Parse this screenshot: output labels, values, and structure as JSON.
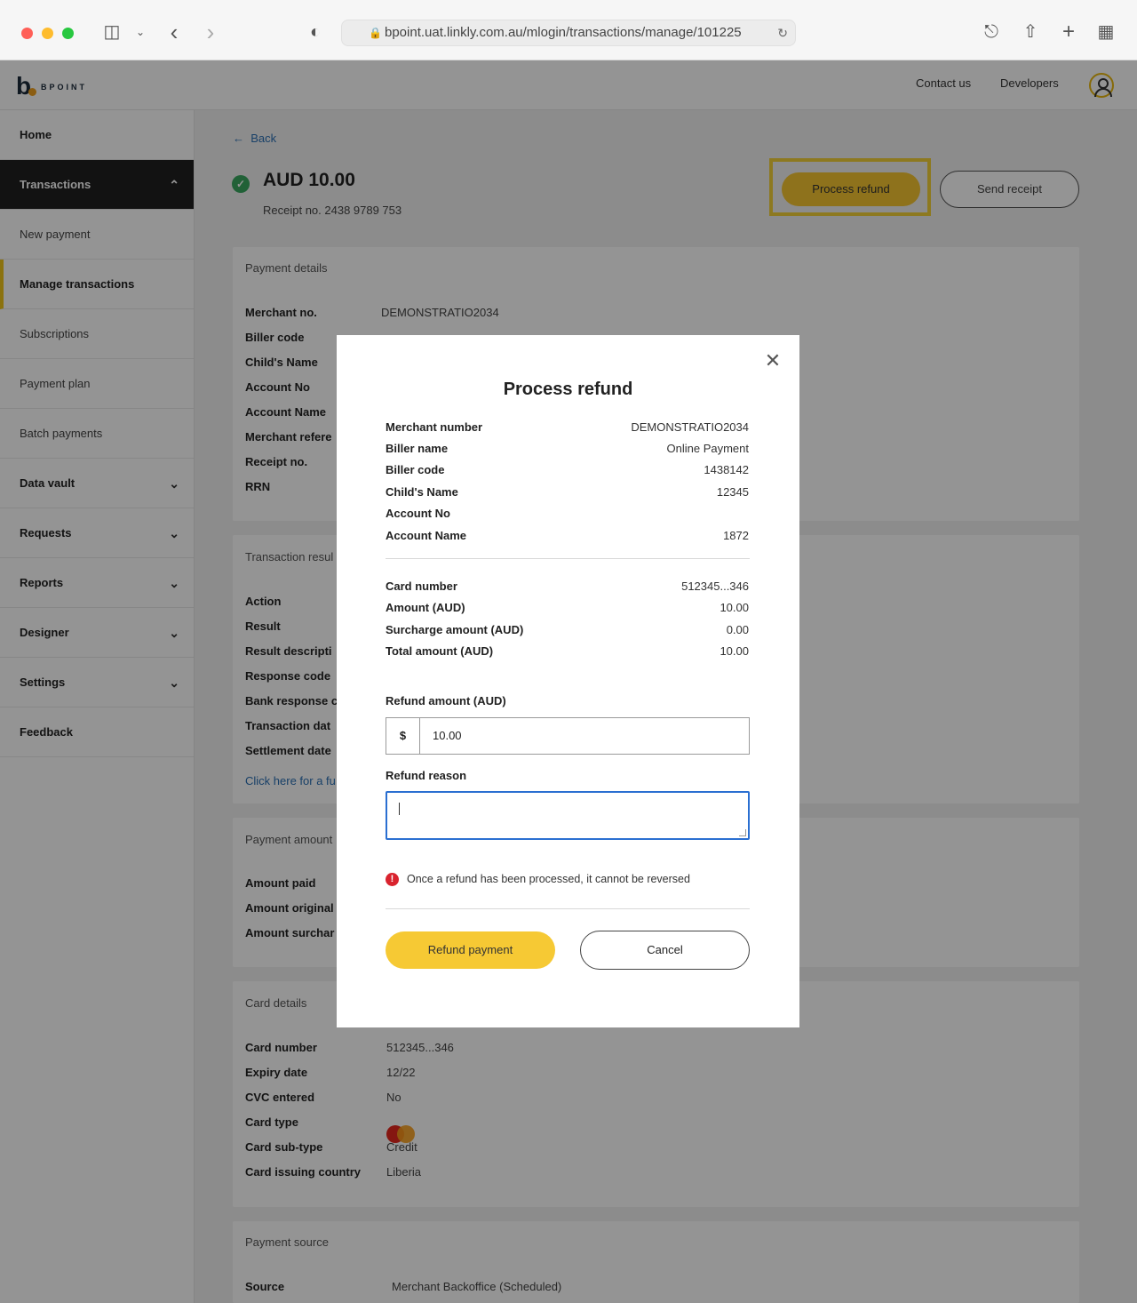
{
  "browser": {
    "url": "bpoint.uat.linkly.com.au/mlogin/transactions/manage/101225"
  },
  "header": {
    "brand": "BPOINT",
    "links": [
      "Contact us",
      "Developers"
    ]
  },
  "sidebar": {
    "items": [
      {
        "label": "Home"
      },
      {
        "label": "Transactions"
      },
      {
        "label": "New payment"
      },
      {
        "label": "Manage transactions"
      },
      {
        "label": "Subscriptions"
      },
      {
        "label": "Payment plan"
      },
      {
        "label": "Batch payments"
      },
      {
        "label": "Data vault"
      },
      {
        "label": "Requests"
      },
      {
        "label": "Reports"
      },
      {
        "label": "Designer"
      },
      {
        "label": "Settings"
      },
      {
        "label": "Feedback"
      }
    ]
  },
  "page": {
    "back": "Back",
    "amount": "AUD 10.00",
    "receipt": "Receipt no. 2438 9789 753",
    "process_refund": "Process refund",
    "send_receipt": "Send receipt",
    "status_color": "#3aa860",
    "accent_color": "#f4c431"
  },
  "payment_details": {
    "title": "Payment details",
    "rows": [
      {
        "label": "Merchant no.",
        "value": "DEMONSTRATIO2034"
      },
      {
        "label": "Biller code",
        "value": ""
      },
      {
        "label": "Child's Name",
        "value": ""
      },
      {
        "label": "Account No",
        "value": ""
      },
      {
        "label": "Account Name",
        "value": ""
      },
      {
        "label": "Merchant refere",
        "value": ""
      },
      {
        "label": "Receipt no.",
        "value": ""
      },
      {
        "label": "RRN",
        "value": ""
      }
    ]
  },
  "transaction_result": {
    "title": "Transaction resul",
    "rows": [
      {
        "label": "Action"
      },
      {
        "label": "Result"
      },
      {
        "label": "Result descripti"
      },
      {
        "label": "Response code"
      },
      {
        "label": "Bank response c"
      },
      {
        "label": "Transaction dat"
      },
      {
        "label": "Settlement date"
      }
    ],
    "link": "Click here for a fu"
  },
  "payment_amount": {
    "title": "Payment amount",
    "rows": [
      {
        "label": "Amount paid"
      },
      {
        "label": "Amount original"
      },
      {
        "label": "Amount surchar"
      }
    ]
  },
  "card_details": {
    "title": "Card details",
    "rows": [
      {
        "label": "Card number",
        "value": "512345...346"
      },
      {
        "label": "Expiry date",
        "value": "12/22"
      },
      {
        "label": "CVC entered",
        "value": "No"
      },
      {
        "label": "Card type",
        "value": ""
      },
      {
        "label": "Card sub-type",
        "value": "Credit"
      },
      {
        "label": "Card issuing country",
        "value": "Liberia"
      }
    ],
    "card_type_icon": "mastercard-icon"
  },
  "payment_source": {
    "title": "Payment source",
    "rows": [
      {
        "label": "Source",
        "value": "Merchant Backoffice (Scheduled)"
      }
    ]
  },
  "modal": {
    "title": "Process refund",
    "details": [
      {
        "label": "Merchant number",
        "value": "DEMONSTRATIO2034"
      },
      {
        "label": "Biller name",
        "value": "Online Payment"
      },
      {
        "label": "Biller code",
        "value": "1438142"
      },
      {
        "label": "Child's Name",
        "value": "12345"
      },
      {
        "label": "Account No",
        "value": ""
      },
      {
        "label": "Account Name",
        "value": "1872"
      }
    ],
    "amounts": [
      {
        "label": "Card number",
        "value": "512345...346"
      },
      {
        "label": "Amount (AUD)",
        "value": "10.00"
      },
      {
        "label": "Surcharge amount (AUD)",
        "value": "0.00"
      },
      {
        "label": "Total amount (AUD)",
        "value": "10.00"
      }
    ],
    "refund_amount_label": "Refund amount (AUD)",
    "currency_symbol": "$",
    "refund_amount_value": "10.00",
    "refund_reason_label": "Refund reason",
    "warning": "Once a refund has been processed, it cannot be reversed",
    "refund_button": "Refund payment",
    "cancel_button": "Cancel"
  }
}
